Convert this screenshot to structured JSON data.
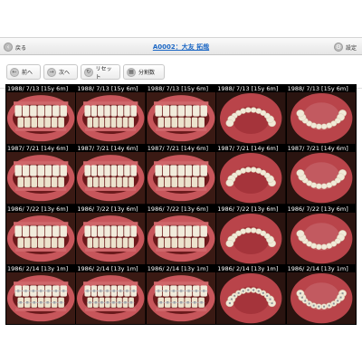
{
  "header": {
    "back_label": "戻る",
    "patient_title": "A0002：大友 拓哉",
    "settings_label": "設定"
  },
  "toolbar": {
    "prev_label": "前へ",
    "next_label": "次へ",
    "reset_label": "リセット",
    "split_label": "分割数"
  },
  "grid": {
    "rows": [
      {
        "caption": "1988/ 7/13 [15y 6m]",
        "views": [
          "front-right",
          "frontal",
          "front-left",
          "maxillary-occlusal",
          "mandibular-occlusal"
        ]
      },
      {
        "caption": "1987/ 7/21 [14y 6m]",
        "views": [
          "front-right",
          "frontal",
          "front-left",
          "maxillary-occlusal",
          "mandibular-occlusal"
        ]
      },
      {
        "caption": "1986/ 7/22 [13y 6m]",
        "views": [
          "front-right",
          "frontal",
          "front-left",
          "maxillary-occlusal",
          "mandibular-occlusal"
        ]
      },
      {
        "caption": "1986/ 2/14 [13y 1m]",
        "views": [
          "front-right",
          "frontal",
          "front-left",
          "maxillary-occlusal",
          "mandibular-occlusal"
        ]
      }
    ],
    "braces_row": 3
  },
  "icons": {
    "back": "back-arrow-icon",
    "settings": "gear-icon",
    "prev": "arrow-left-icon",
    "next": "arrow-right-icon",
    "reset": "reset-icon",
    "split": "grid-icon"
  },
  "colors": {
    "title_link": "#1a66c4",
    "caption_text": "#ffffff",
    "grid_bg": "#000000"
  }
}
